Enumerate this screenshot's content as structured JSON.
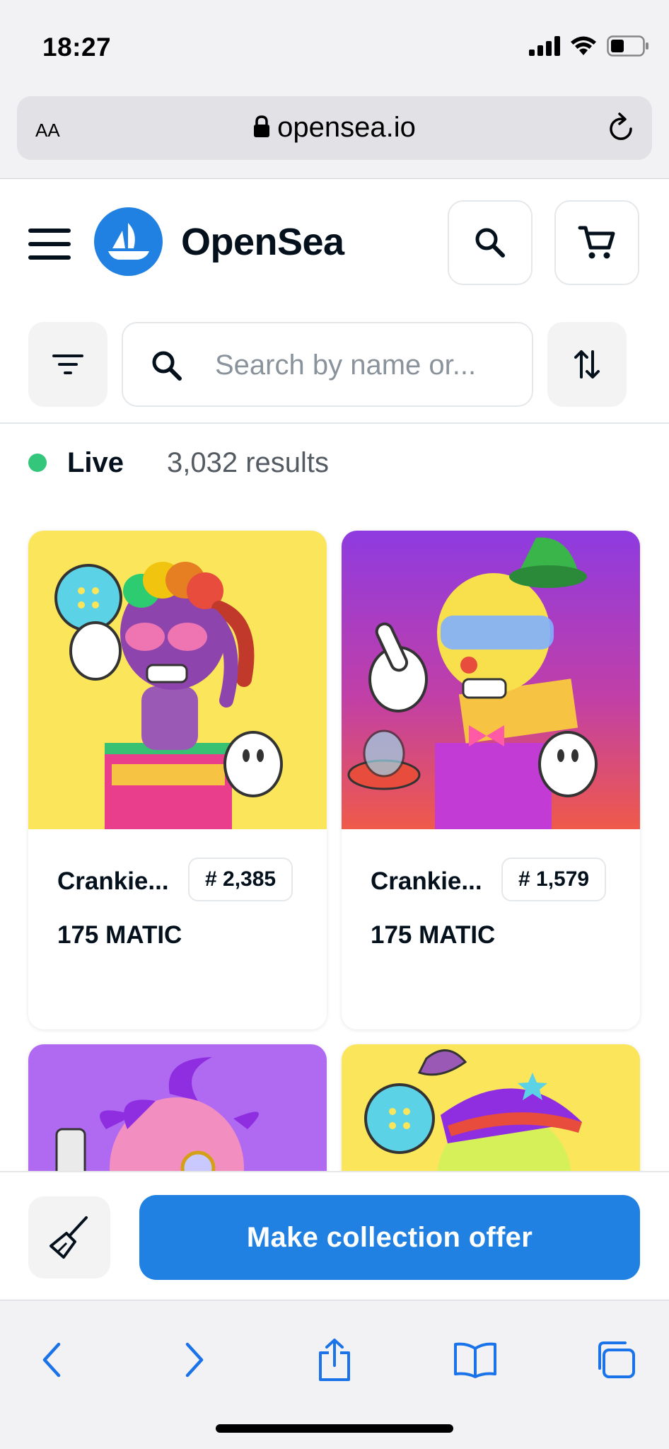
{
  "status_bar": {
    "time": "18:27",
    "icons": [
      "cellular-signal-icon",
      "wifi-icon",
      "battery-icon"
    ]
  },
  "browser": {
    "text_size_label": "AA",
    "url": "opensea.io",
    "icons": [
      "lock-icon",
      "reload-icon"
    ]
  },
  "header": {
    "brand_name": "OpenSea",
    "brand_color": "#2081e2",
    "icons": [
      "hamburger-menu-icon",
      "opensea-logo-icon",
      "search-icon",
      "cart-icon"
    ]
  },
  "search": {
    "placeholder": "Search by name or..."
  },
  "results": {
    "status_label": "Live",
    "status_color": "#34c77b",
    "count_text": "3,032 results"
  },
  "items": [
    {
      "name": "Crankie...",
      "token": "# 2,385",
      "price": "175 MATIC"
    },
    {
      "name": "Crankie...",
      "token": "# 1,579",
      "price": "175 MATIC"
    },
    {
      "name": "",
      "token": "",
      "price": ""
    },
    {
      "name": "",
      "token": "",
      "price": ""
    }
  ],
  "actions": {
    "collection_offer_label": "Make collection offer",
    "icons": [
      "sweep-broom-icon"
    ]
  },
  "safari_toolbar": {
    "icons": [
      "back-icon",
      "forward-icon",
      "share-icon",
      "bookmarks-icon",
      "tabs-icon"
    ],
    "accent_color": "#1a73e8"
  }
}
